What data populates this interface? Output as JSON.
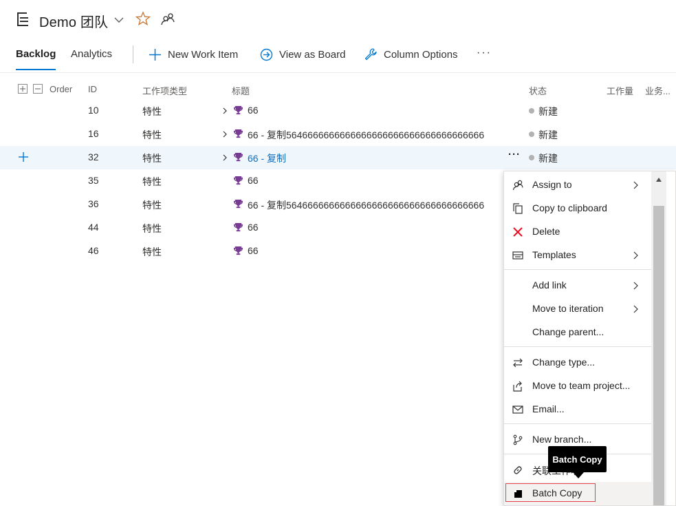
{
  "header": {
    "team_title": "Demo 团队"
  },
  "tabs": {
    "backlog": "Backlog",
    "analytics": "Analytics"
  },
  "toolbar": {
    "new_work_item": "New Work Item",
    "view_as_board": "View as Board",
    "column_options": "Column Options",
    "more": "···"
  },
  "columns": {
    "order": "Order",
    "id": "ID",
    "type": "工作项类型",
    "title": "标题",
    "state": "状态",
    "effort": "工作量",
    "business": "业务..."
  },
  "rows": [
    {
      "id": "10",
      "type": "特性",
      "title": "66",
      "state": "新建",
      "expandable": true,
      "selected": false
    },
    {
      "id": "16",
      "type": "特性",
      "title": "66 - 复制5646666666666666666666666666666666666",
      "state": "新建",
      "expandable": true,
      "selected": false
    },
    {
      "id": "32",
      "type": "特性",
      "title": "66 - 复制",
      "state": "新建",
      "expandable": true,
      "selected": true
    },
    {
      "id": "35",
      "type": "特性",
      "title": "66",
      "state": "",
      "expandable": false,
      "selected": false
    },
    {
      "id": "36",
      "type": "特性",
      "title": "66 - 复制5646666666666666666666666666666666666",
      "state": "",
      "expandable": false,
      "selected": false
    },
    {
      "id": "44",
      "type": "特性",
      "title": "66",
      "state": "",
      "expandable": false,
      "selected": false
    },
    {
      "id": "46",
      "type": "特性",
      "title": "66",
      "state": "",
      "expandable": false,
      "selected": false
    }
  ],
  "row_more": "···",
  "context_menu": {
    "assign_to": "Assign to",
    "copy_to_clipboard": "Copy to clipboard",
    "delete": "Delete",
    "templates": "Templates",
    "add_link": "Add link",
    "move_to_iteration": "Move to iteration",
    "change_parent": "Change parent...",
    "change_type": "Change type...",
    "move_to_team_project": "Move to team project...",
    "email": "Email...",
    "new_branch": "New branch...",
    "link_related": "关联工作项",
    "batch_copy": "Batch Copy"
  },
  "tooltip": {
    "text": "Batch Copy"
  },
  "colors": {
    "accent": "#0078d4",
    "trophy": "#773b93",
    "delete_red": "#e81123",
    "selected_row": "#eff6fc",
    "star": "#c87533"
  }
}
